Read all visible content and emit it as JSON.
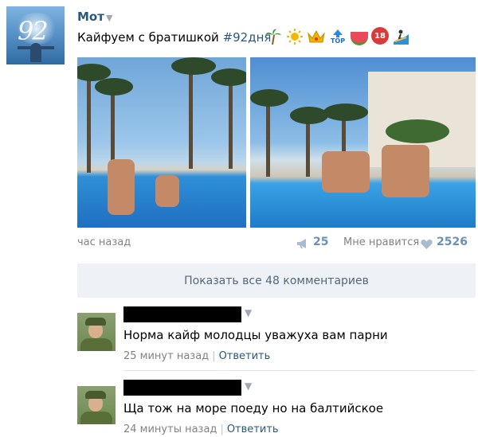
{
  "post": {
    "author": "Мот",
    "text_plain": "Кайфуем с братишкой ",
    "hashtag": "#92дня",
    "emojis": [
      "palm-tree",
      "sun",
      "crown",
      "top-arrow",
      "watermelon",
      "no-under-18",
      "surfer"
    ],
    "top_label": "TOP",
    "eighteen_label": "18",
    "avatar_number": "92",
    "time": "час назад",
    "shares": "25",
    "like_label": "Мне нравится",
    "likes": "2526"
  },
  "show_all_comments": "Показать все 48 комментариев",
  "comments": [
    {
      "text": "Норма кайф молодцы уважуха вам парни",
      "time": "25 минут назад",
      "sep": "|",
      "reply": "Ответить"
    },
    {
      "text": "Ща тож на море поеду но на балтийское",
      "time": "24 минуты назад",
      "sep": "|",
      "reply": "Ответить"
    }
  ],
  "colors": {
    "author": "#2b587a",
    "meta": "#828282",
    "counts": "#6d8fb3",
    "button_bg": "#eef1f5"
  }
}
